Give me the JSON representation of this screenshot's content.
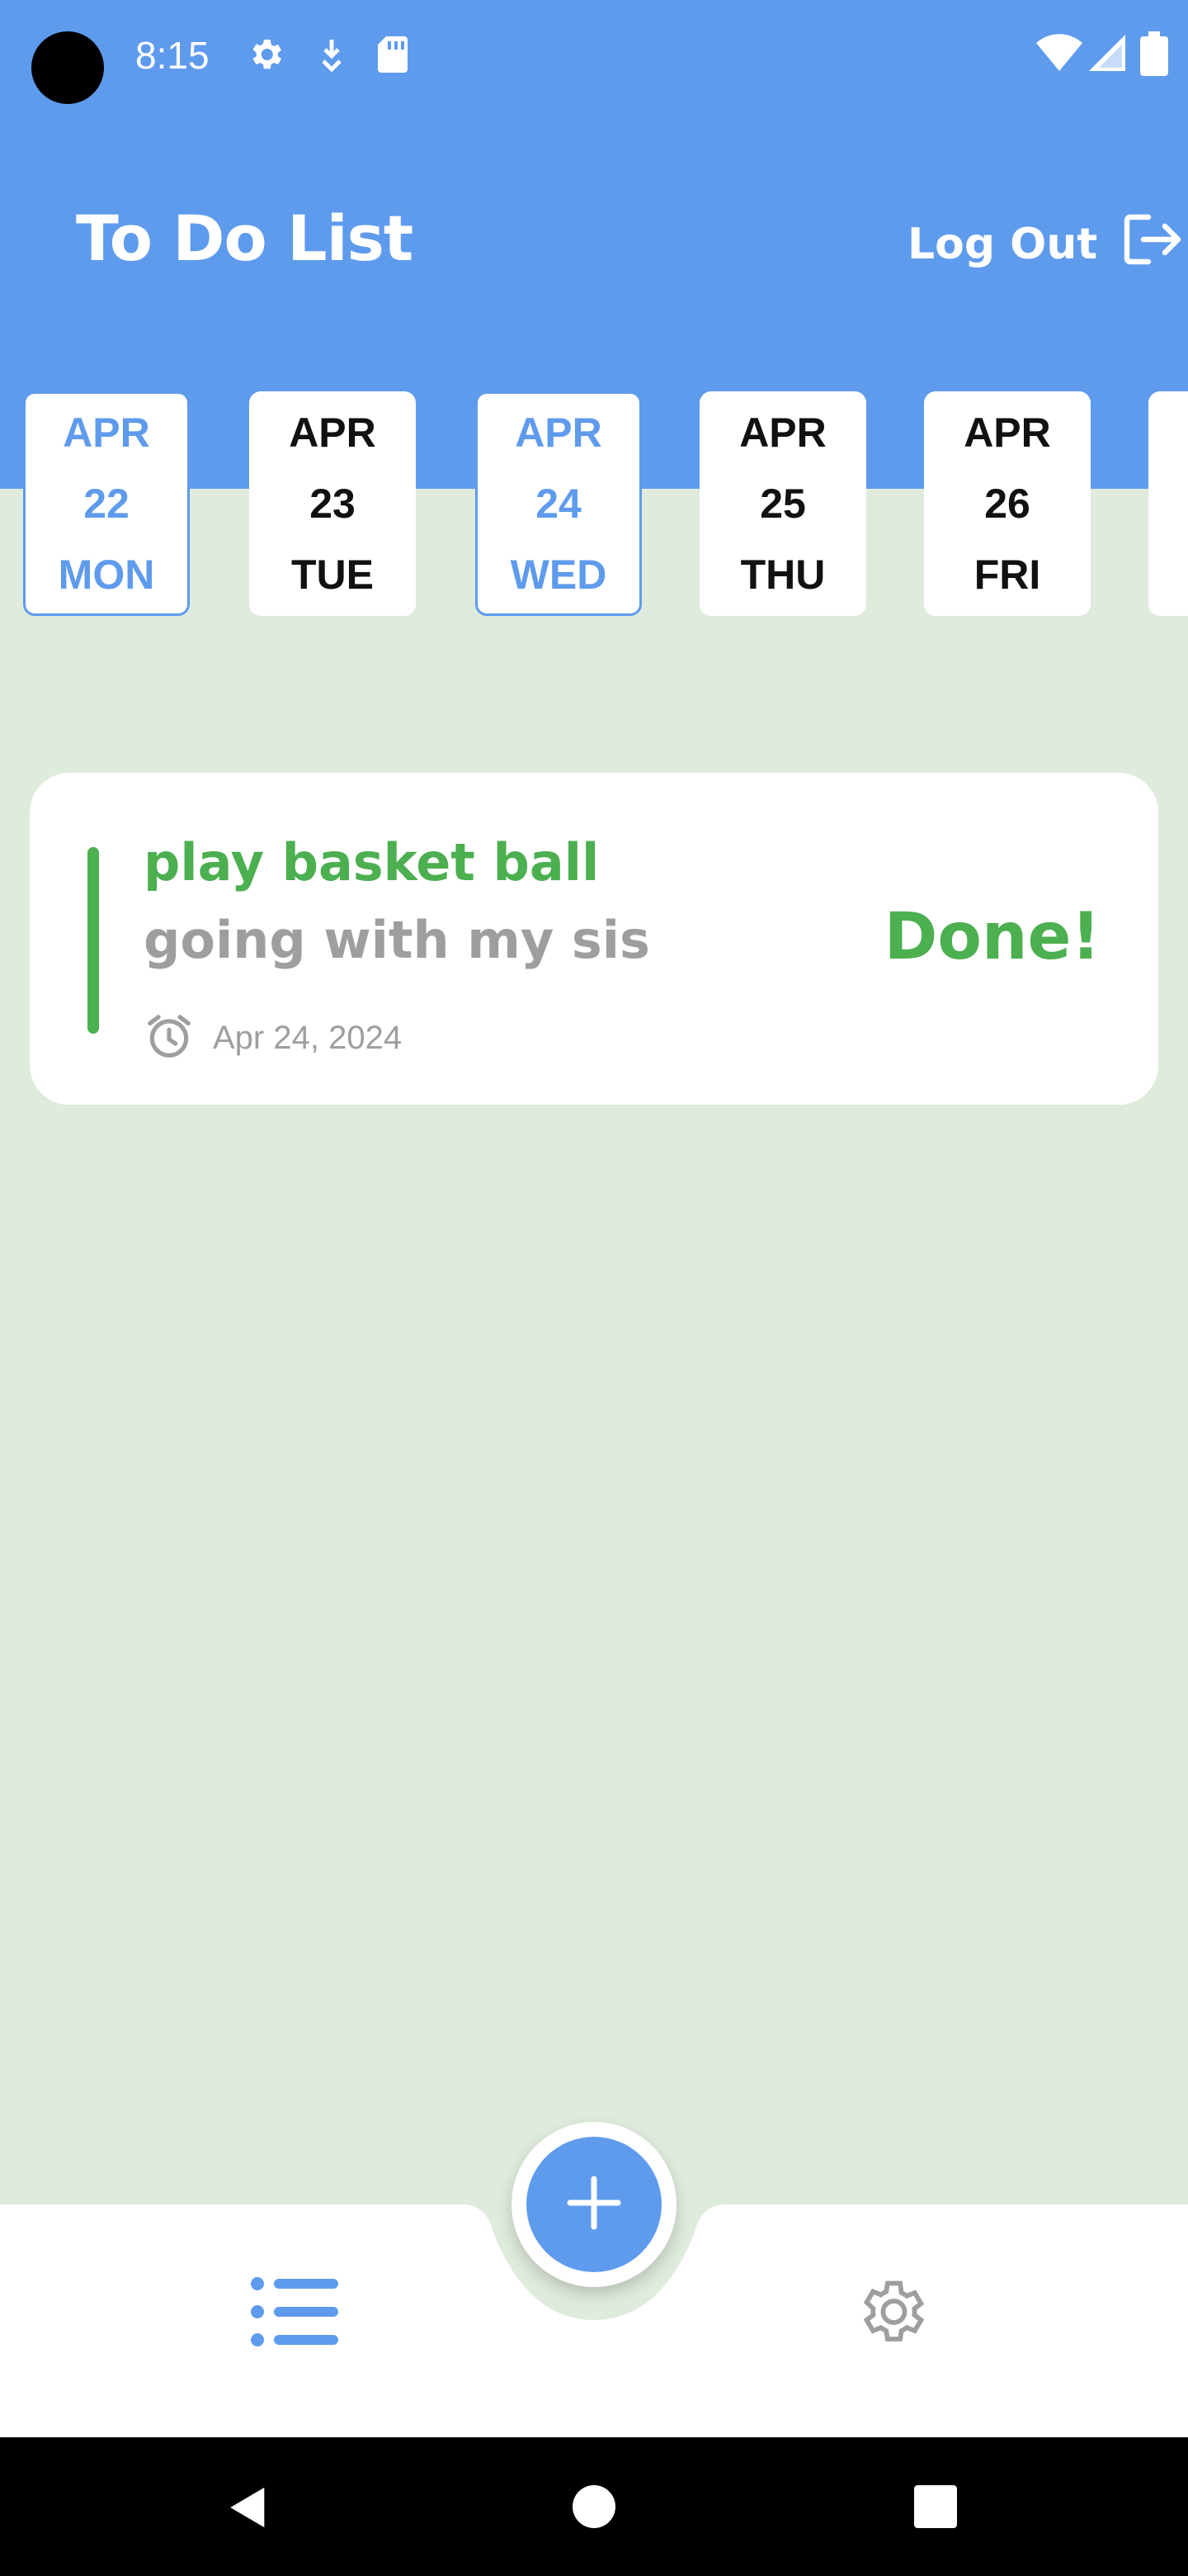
{
  "status_bar": {
    "time": "8:15"
  },
  "header": {
    "title": "To Do List",
    "logout_label": "Log Out"
  },
  "dates": [
    {
      "month": "APR",
      "day": "22",
      "weekday": "MON",
      "selected": true
    },
    {
      "month": "APR",
      "day": "23",
      "weekday": "TUE",
      "selected": false
    },
    {
      "month": "APR",
      "day": "24",
      "weekday": "WED",
      "selected": true
    },
    {
      "month": "APR",
      "day": "25",
      "weekday": "THU",
      "selected": false
    },
    {
      "month": "APR",
      "day": "26",
      "weekday": "FRI",
      "selected": false
    }
  ],
  "task": {
    "title": "play basket ball",
    "description": "going with my sis",
    "date": "Apr 24, 2024",
    "status": "Done!"
  },
  "icons": {
    "logout": "logout-icon",
    "alarm": "alarm-clock-icon",
    "add": "plus-icon",
    "list": "list-icon",
    "settings": "gear-icon"
  },
  "colors": {
    "primary": "#5f9bec",
    "background": "#dfebdc",
    "success": "#4caf50",
    "muted": "#9e9e9e"
  }
}
